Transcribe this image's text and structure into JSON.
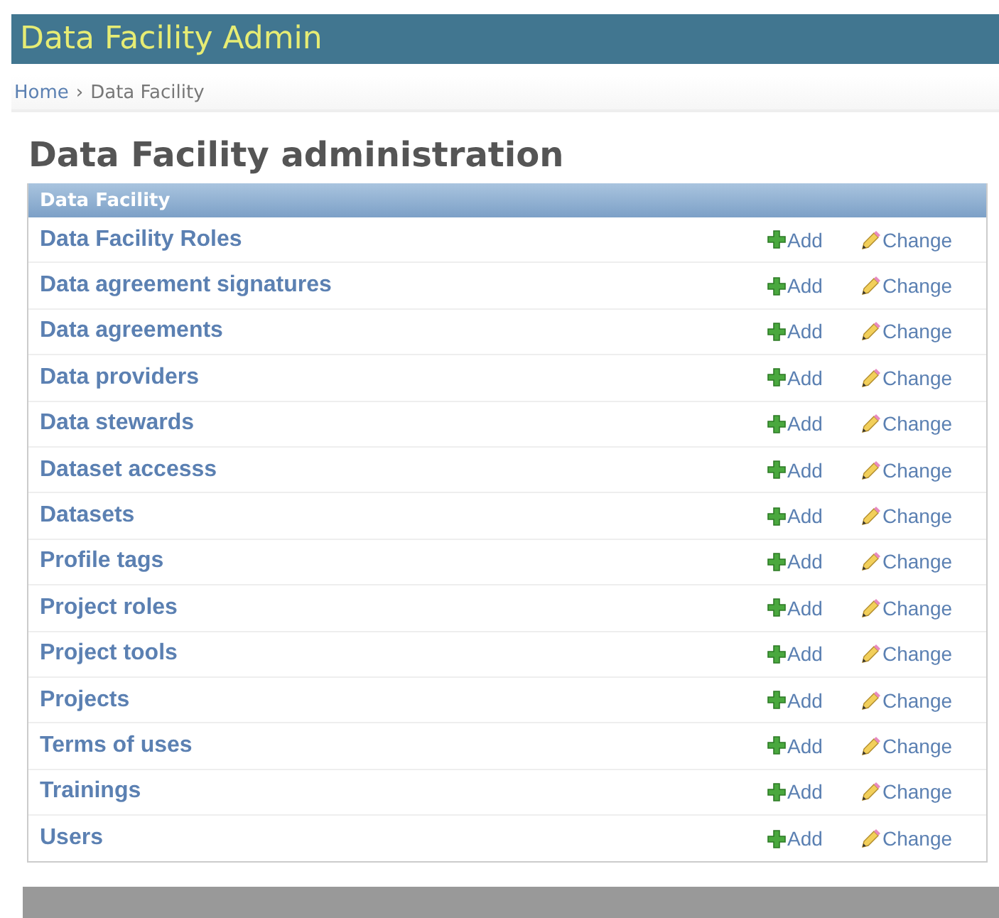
{
  "header": {
    "title": "Data Facility Admin"
  },
  "breadcrumbs": {
    "home": "Home",
    "separator": "›",
    "current": "Data Facility"
  },
  "page_title": "Data Facility administration",
  "module": {
    "caption": "Data Facility",
    "rows": [
      {
        "name": "Data Facility Roles",
        "add": "Add",
        "change": "Change"
      },
      {
        "name": "Data agreement signatures",
        "add": "Add",
        "change": "Change"
      },
      {
        "name": "Data agreements",
        "add": "Add",
        "change": "Change"
      },
      {
        "name": "Data providers",
        "add": "Add",
        "change": "Change"
      },
      {
        "name": "Data stewards",
        "add": "Add",
        "change": "Change"
      },
      {
        "name": "Dataset accesss",
        "add": "Add",
        "change": "Change"
      },
      {
        "name": "Datasets",
        "add": "Add",
        "change": "Change"
      },
      {
        "name": "Profile tags",
        "add": "Add",
        "change": "Change"
      },
      {
        "name": "Project roles",
        "add": "Add",
        "change": "Change"
      },
      {
        "name": "Project tools",
        "add": "Add",
        "change": "Change"
      },
      {
        "name": "Projects",
        "add": "Add",
        "change": "Change"
      },
      {
        "name": "Terms of uses",
        "add": "Add",
        "change": "Change"
      },
      {
        "name": "Trainings",
        "add": "Add",
        "change": "Change"
      },
      {
        "name": "Users",
        "add": "Add",
        "change": "Change"
      }
    ]
  }
}
